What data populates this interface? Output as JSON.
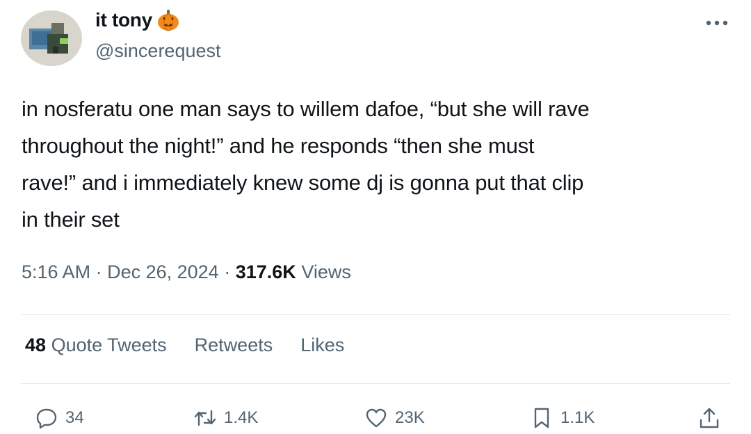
{
  "author": {
    "display_name": "it tony",
    "handle": "@sincerequest",
    "emoji_icon": "jack-o-lantern"
  },
  "tweet": {
    "text_lines": [
      "in nosferatu one man says to willem dafoe, “but she will rave",
      "throughout the night!” and he responds “then she must",
      "rave!” and i immediately knew some dj is gonna put that clip",
      "in their set"
    ],
    "time": "5:16 AM",
    "date": "Dec 26, 2024",
    "views_count": "317.6K",
    "views_label": "Views"
  },
  "stats": {
    "quote_count": "48",
    "quote_label": "Quote Tweets",
    "retweets_label": "Retweets",
    "likes_label": "Likes"
  },
  "actions": {
    "reply_count": "34",
    "retweet_count": "1.4K",
    "like_count": "23K",
    "bookmark_count": "1.1K"
  },
  "colors": {
    "text": "#0f1419",
    "secondary": "#536471",
    "divider": "#e6e9eb"
  }
}
